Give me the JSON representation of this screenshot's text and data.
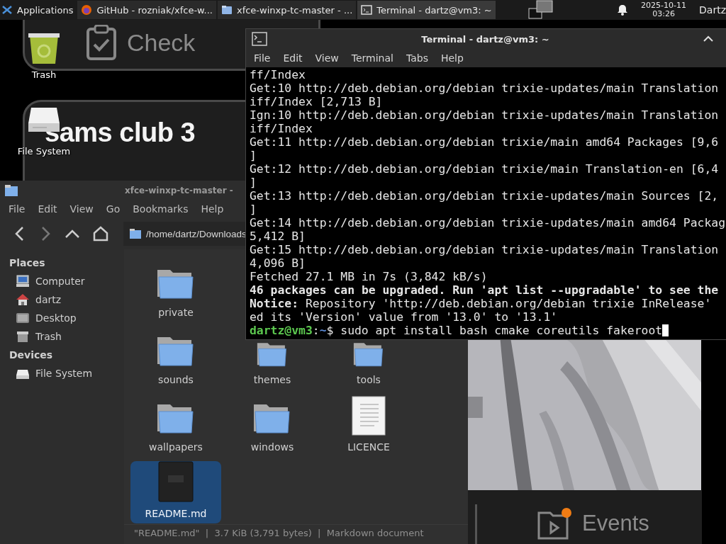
{
  "panel": {
    "menu_label": "Applications",
    "tasks": [
      {
        "kind": "browser",
        "label": "GitHub - rozniak/xfce-w...",
        "selected": false
      },
      {
        "kind": "folder",
        "label": "xfce-winxp-tc-master - ...",
        "selected": false
      },
      {
        "kind": "terminal",
        "label": "Terminal - dartz@vm3: ~",
        "selected": true
      }
    ],
    "clock_date": "2025-10-11",
    "clock_time": "03:26",
    "user": "Dartz"
  },
  "background_app": {
    "check_label": "Check",
    "camera_name": "sams club 3",
    "events_label": "Events"
  },
  "desktop_icons": [
    {
      "kind": "trash",
      "label": "Trash"
    },
    {
      "kind": "drive",
      "label": "File System"
    }
  ],
  "file_manager": {
    "title": "xfce-winxp-tc-master -",
    "menu": [
      "File",
      "Edit",
      "View",
      "Go",
      "Bookmarks",
      "Help"
    ],
    "path": "/home/dartz/Downloads",
    "sidebar": [
      {
        "heading": "Places",
        "items": [
          {
            "kind": "computer",
            "label": "Computer"
          },
          {
            "kind": "home",
            "label": "dartz"
          },
          {
            "kind": "desktop",
            "label": "Desktop"
          },
          {
            "kind": "trash",
            "label": "Trash"
          }
        ]
      },
      {
        "heading": "Devices",
        "items": [
          {
            "kind": "drive",
            "label": "File System"
          }
        ]
      }
    ],
    "rows": [
      {
        "items": [
          {
            "kind": "folder",
            "label": "private",
            "selected": false
          }
        ]
      },
      {
        "items": [
          {
            "kind": "folder",
            "label": "sounds",
            "selected": false
          },
          {
            "kind": "folder",
            "label": "themes",
            "selected": false
          },
          {
            "kind": "folder",
            "label": "tools",
            "selected": false
          }
        ]
      },
      {
        "items": [
          {
            "kind": "folder",
            "label": "wallpapers",
            "selected": false
          },
          {
            "kind": "folder",
            "label": "windows",
            "selected": false
          },
          {
            "kind": "document",
            "label": "LICENCE",
            "selected": false
          }
        ]
      },
      {
        "items": [
          {
            "kind": "markdown",
            "label": "README.md",
            "selected": true
          }
        ]
      }
    ],
    "status": "\"README.md\"  |  3.7 KiB (3,791 bytes)  |  Markdown document"
  },
  "terminal": {
    "title": "Terminal - dartz@vm3: ~",
    "menu": [
      "File",
      "Edit",
      "View",
      "Terminal",
      "Tabs",
      "Help"
    ],
    "lines": [
      {
        "kind": "plain",
        "text": "ff/Index"
      },
      {
        "kind": "plain",
        "text": "Get:10 http://deb.debian.org/debian trixie-updates/main Translation"
      },
      {
        "kind": "plain",
        "text": "iff/Index [2,713 B]"
      },
      {
        "kind": "plain",
        "text": "Ign:10 http://deb.debian.org/debian trixie-updates/main Translation"
      },
      {
        "kind": "plain",
        "text": "iff/Index"
      },
      {
        "kind": "plain",
        "text": "Get:11 http://deb.debian.org/debian trixie/main amd64 Packages [9,6"
      },
      {
        "kind": "plain",
        "text": "]"
      },
      {
        "kind": "plain",
        "text": "Get:12 http://deb.debian.org/debian trixie/main Translation-en [6,4"
      },
      {
        "kind": "plain",
        "text": "]"
      },
      {
        "kind": "plain",
        "text": "Get:13 http://deb.debian.org/debian trixie-updates/main Sources [2,"
      },
      {
        "kind": "plain",
        "text": "]"
      },
      {
        "kind": "plain",
        "text": "Get:14 http://deb.debian.org/debian trixie-updates/main amd64 Packag"
      },
      {
        "kind": "plain",
        "text": "5,412 B]"
      },
      {
        "kind": "plain",
        "text": "Get:15 http://deb.debian.org/debian trixie-updates/main Translation"
      },
      {
        "kind": "plain",
        "text": "4,096 B]"
      },
      {
        "kind": "plain",
        "text": "Fetched 27.1 MB in 7s (3,842 kB/s)"
      },
      {
        "kind": "bold",
        "text": "46 packages can be upgraded. Run 'apt list --upgradable' to see the"
      },
      {
        "kind": "rich",
        "text": "**Notice:** Repository 'http://deb.debian.org/debian trixie InRelease'"
      },
      {
        "kind": "plain",
        "text": "ed its 'Version' value from '13.0' to '13.1'"
      }
    ],
    "prompt": {
      "user": "dartz@vm3",
      "separator": ":",
      "path": "~",
      "symbol": "$",
      "command": "sudo apt install bash cmake coreutils fakeroot"
    }
  }
}
